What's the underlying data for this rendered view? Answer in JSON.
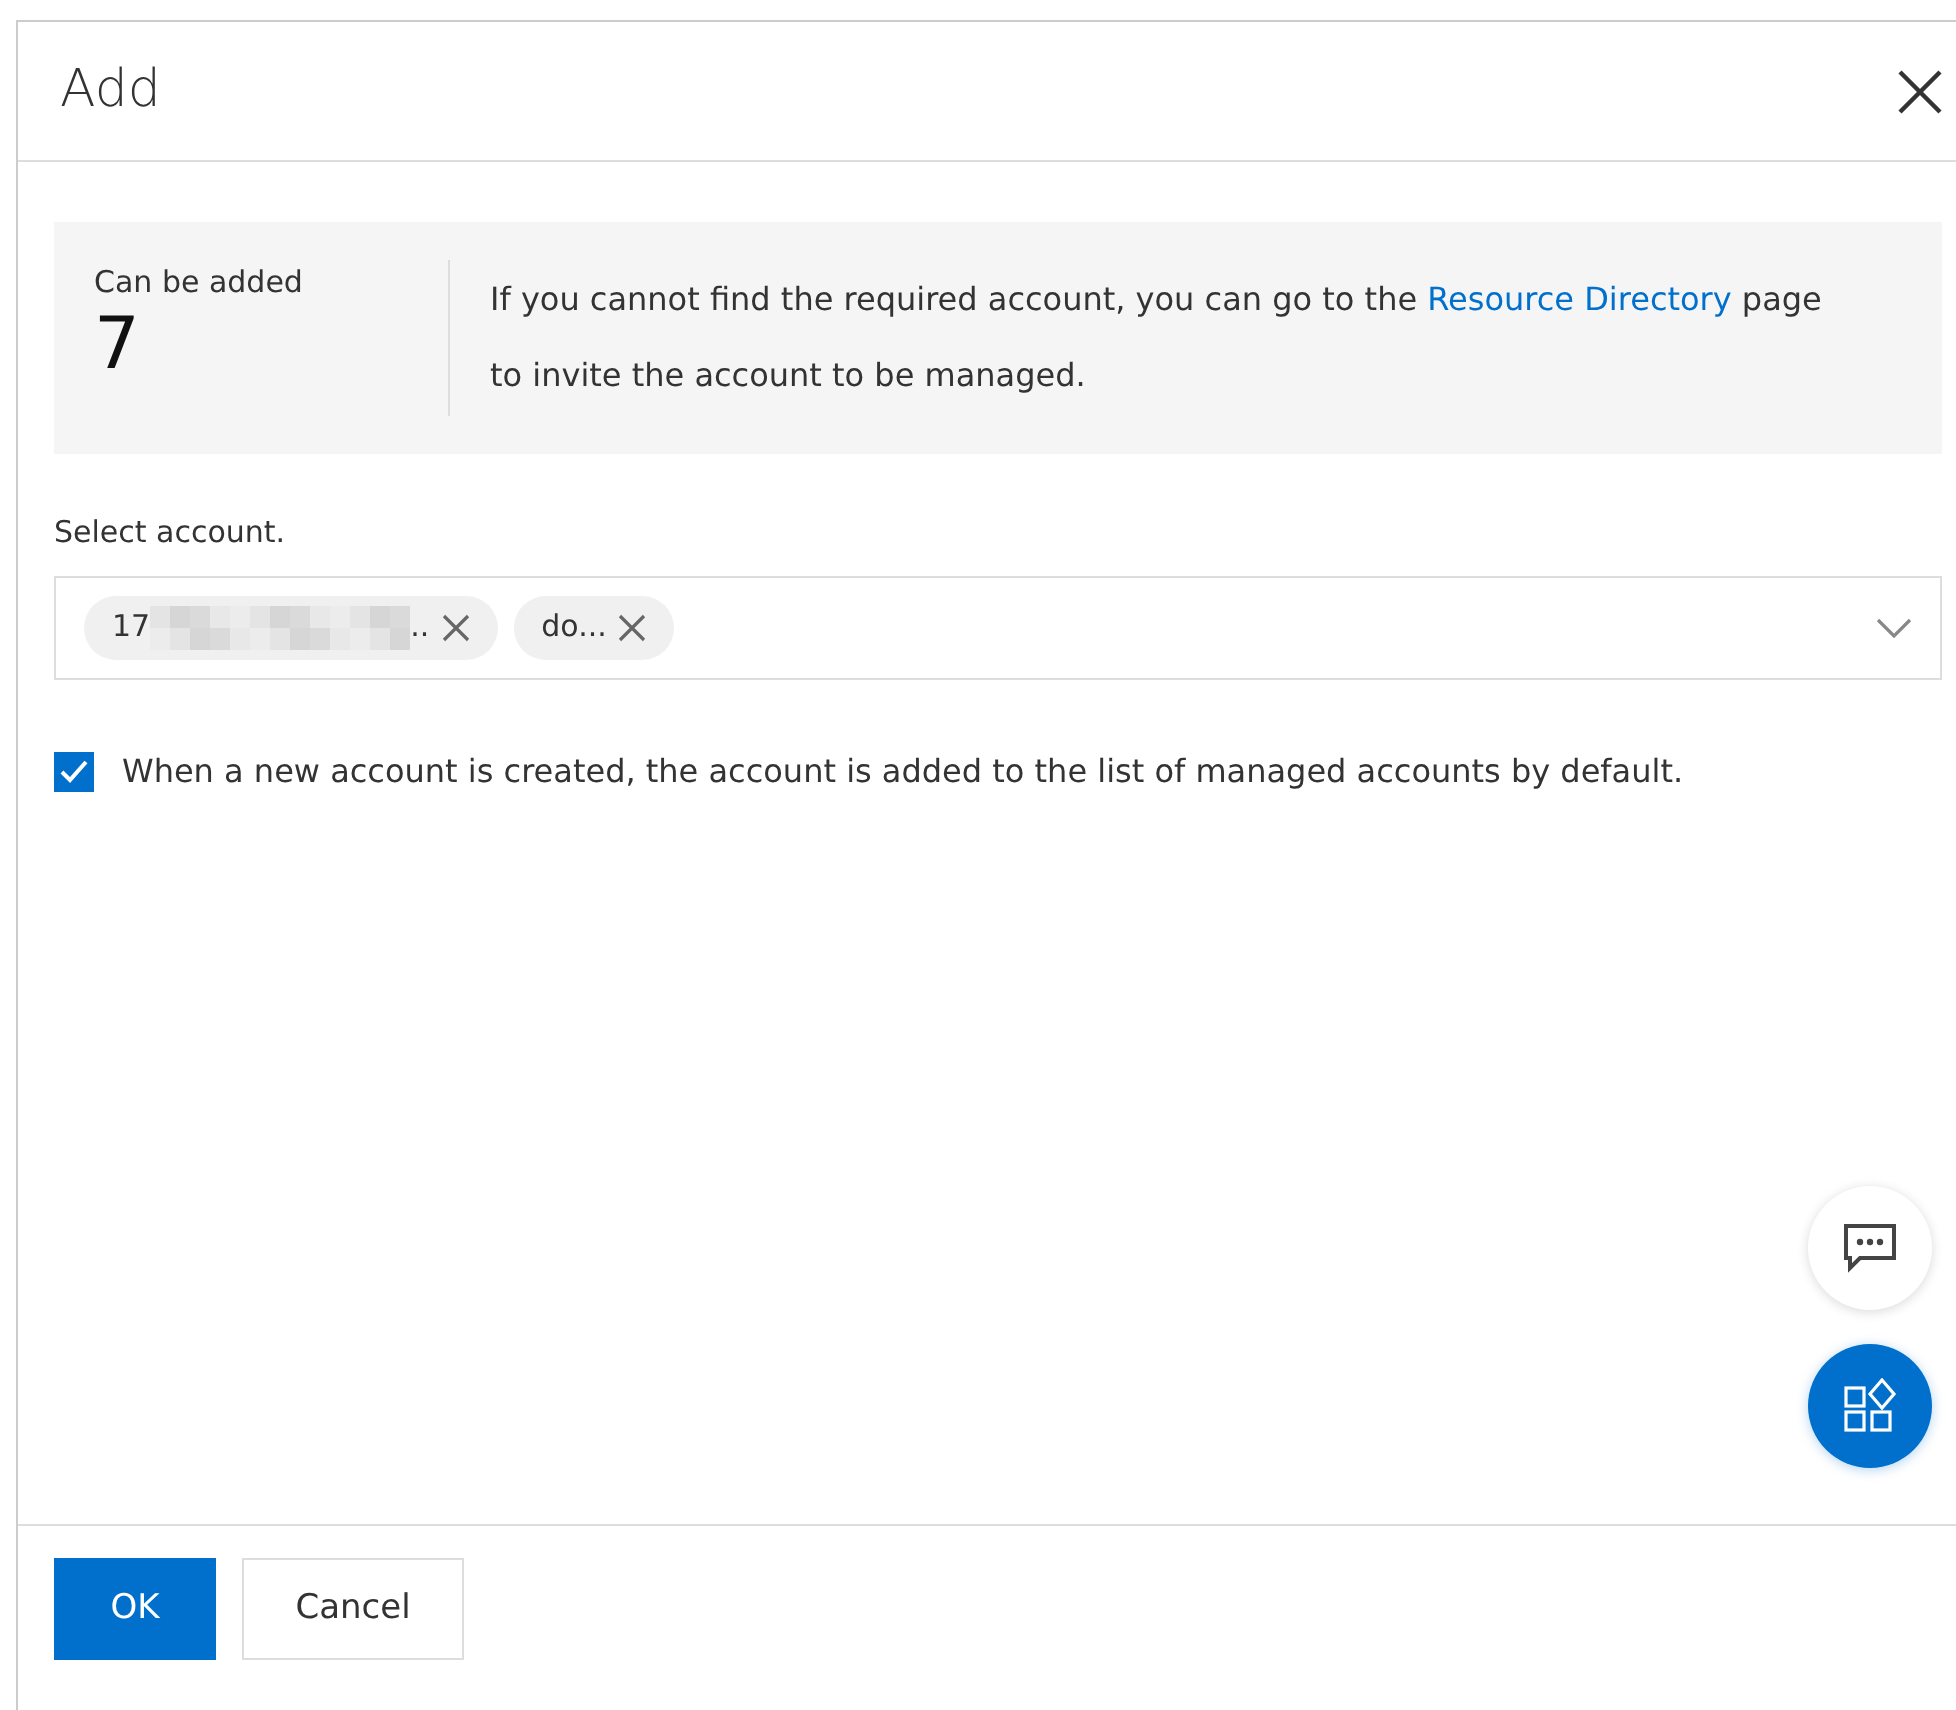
{
  "dialog": {
    "title": "Add"
  },
  "summary": {
    "label": "Can be added",
    "count": "7",
    "message_before": "If you cannot find the required account, you can go to the",
    "link": "Resource Directory",
    "message_after": "page to invite the account to be managed."
  },
  "account_select": {
    "label": "Select account.",
    "tags": [
      {
        "text_start": "17",
        "redacted": true,
        "text_end": ".."
      },
      {
        "text_start": "do...",
        "redacted": false
      }
    ]
  },
  "auto_add": {
    "label": "When a new account is created, the account is added to the list of managed accounts by default.",
    "checked": true
  },
  "buttons": [
    {
      "label": "OK",
      "kind": "primary"
    },
    {
      "label": "Cancel",
      "kind": "secondary"
    }
  ]
}
